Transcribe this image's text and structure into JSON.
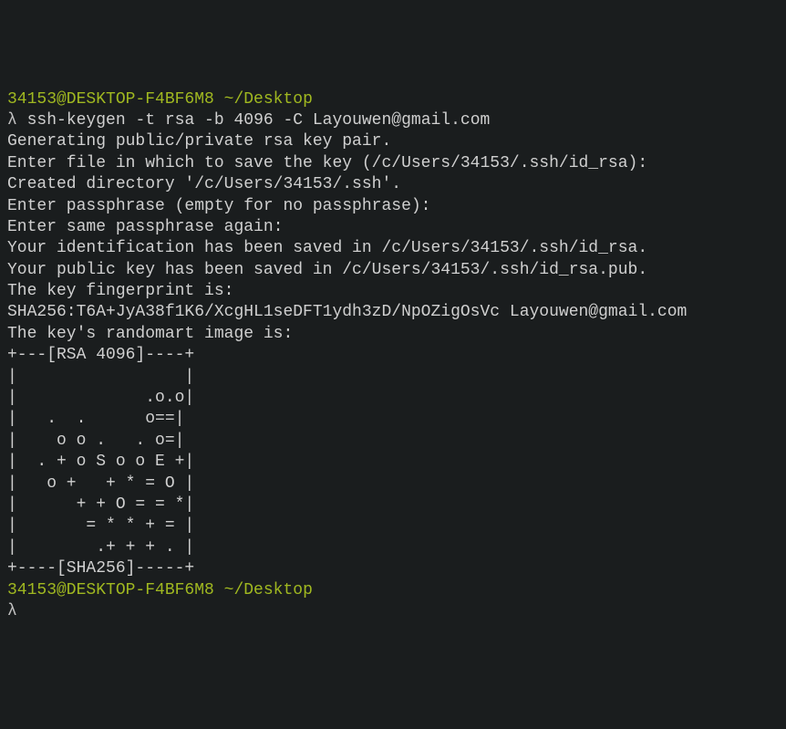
{
  "prompt1": {
    "user_host": "34153@DESKTOP-F4BF6M8",
    "path": "~/Desktop",
    "lambda": "λ",
    "command": "ssh-keygen -t rsa -b 4096 -C Layouwen@gmail.com"
  },
  "output": {
    "l1": "Generating public/private rsa key pair.",
    "l2": "Enter file in which to save the key (/c/Users/34153/.ssh/id_rsa):",
    "l3": "Created directory '/c/Users/34153/.ssh'.",
    "l4": "Enter passphrase (empty for no passphrase):",
    "l5": "Enter same passphrase again:",
    "l6": "Your identification has been saved in /c/Users/34153/.ssh/id_rsa.",
    "l7": "Your public key has been saved in /c/Users/34153/.ssh/id_rsa.pub.",
    "l8": "The key fingerprint is:",
    "l9": "SHA256:T6A+JyA38f1K6/XcgHL1seDFT1ydh3zD/NpOZigOsVc Layouwen@gmail.com",
    "l10": "The key's randomart image is:",
    "l11": "+---[RSA 4096]----+",
    "l12": "|                 |",
    "l13": "|             .o.o|",
    "l14": "|   .  .      o==|",
    "l15": "|    o o .   . o=|",
    "l16": "|  . + o S o o E +|",
    "l17": "|   o +   + * = O |",
    "l18": "|      + + O = = *|",
    "l19": "|       = * * + = |",
    "l20": "|        .+ + + . |",
    "l21": "+----[SHA256]-----+"
  },
  "prompt2": {
    "user_host": "34153@DESKTOP-F4BF6M8",
    "path": "~/Desktop",
    "lambda": "λ"
  }
}
